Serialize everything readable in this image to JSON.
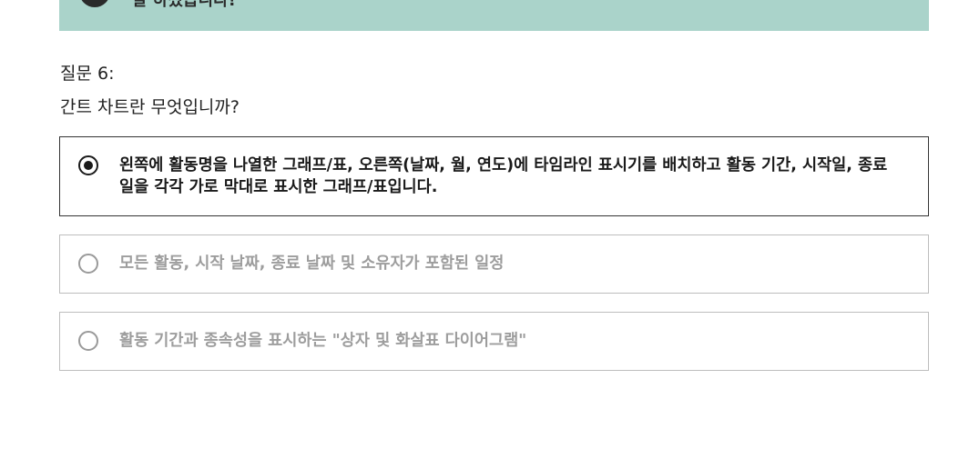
{
  "banner": {
    "text": "잘 하셨습니다!",
    "icon": "check-icon",
    "color": "#aad3ca"
  },
  "question": {
    "label": "질문 6:",
    "text": "간트 차트란 무엇입니까?"
  },
  "options": [
    {
      "text": "왼쪽에 활동명을 나열한 그래프/표, 오른쪽(날짜, 월, 연도)에 타임라인 표시기를 배치하고 활동 기간, 시작일, 종료일을 각각 가로 막대로 표시한 그래프/표입니다.",
      "selected": true
    },
    {
      "text": "모든 활동, 시작 날짜, 종료 날짜 및 소유자가 포함된 일정",
      "selected": false
    },
    {
      "text": "활동 기간과 종속성을 표시하는 \"상자 및 화살표 다이어그램\"",
      "selected": false
    }
  ]
}
